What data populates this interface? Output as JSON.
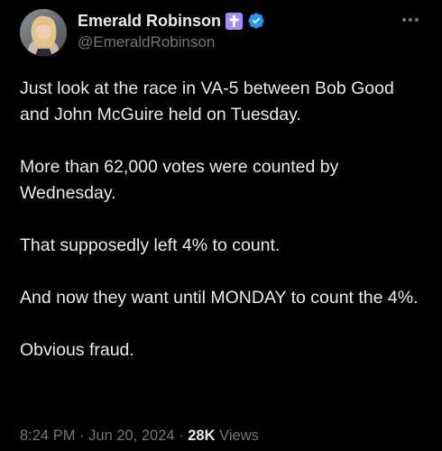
{
  "author": {
    "display_name": "Emerald Robinson",
    "handle": "@EmeraldRobinson",
    "badges": [
      "latin-cross-icon",
      "verified-badge-icon"
    ],
    "avatar": "avatar-photo"
  },
  "tweet": {
    "paragraphs": [
      "Just look at the race in VA-5 between Bob Good and John McGuire held on Tuesday.",
      "More than 62,000 votes were counted by Wednesday.",
      "That supposedly left 4% to count.",
      "And now they want until MONDAY to count the 4%.",
      "Obvious fraud."
    ]
  },
  "meta": {
    "time": "8:24 PM",
    "separator": "·",
    "date": "Jun 20, 2024",
    "views_count": "28K",
    "views_label": "Views"
  },
  "colors": {
    "background": "#000000",
    "text_primary": "#e7e9ea",
    "text_secondary": "#71767b",
    "verified_blue": "#1d9bf0",
    "cross_badge": "#a78bfa"
  },
  "icons": {
    "more": "more-horizontal-icon"
  }
}
